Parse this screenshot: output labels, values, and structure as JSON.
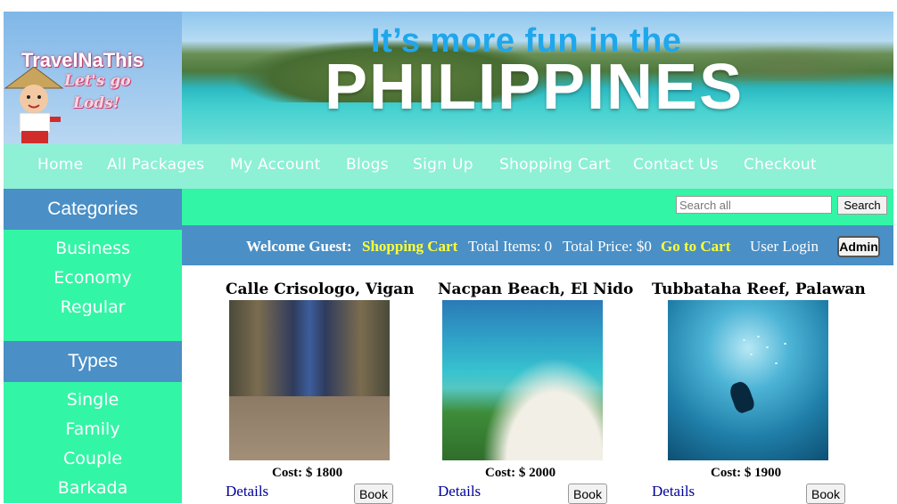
{
  "brand": {
    "name": "TravelNaThis",
    "tagline_line1": "Let's go",
    "tagline_line2": "Lods!"
  },
  "banner": {
    "tagline": "It’s more fun in the",
    "title": "PHILIPPINES"
  },
  "nav": {
    "items": [
      "Home",
      "All Packages",
      "My Account",
      "Blogs",
      "Sign Up",
      "Shopping Cart",
      "Contact Us",
      "Checkout"
    ]
  },
  "sidebar": {
    "categories": {
      "heading": "Categories",
      "items": [
        "Business",
        "Economy",
        "Regular"
      ]
    },
    "types": {
      "heading": "Types",
      "items": [
        "Single",
        "Family",
        "Couple",
        "Barkada"
      ]
    }
  },
  "search": {
    "placeholder": "Search all",
    "button_label": "Search"
  },
  "welcome": {
    "greeting": "Welcome Guest:",
    "cart_label": "Shopping Cart",
    "total_items_label": "Total Items: 0",
    "total_price_label": "Total Price: $0",
    "go_to_cart": "Go to Cart",
    "user_login": "User Login",
    "admin_button": "Admin"
  },
  "packages": [
    {
      "title": "Calle Crisologo, Vigan",
      "cost": "Cost: $ 1800",
      "details": "Details",
      "book": "Book"
    },
    {
      "title": "Nacpan Beach, El Nido",
      "cost": "Cost: $ 2000",
      "details": "Details",
      "book": "Book"
    },
    {
      "title": "Tubbataha Reef, Palawan",
      "cost": "Cost: $ 1900",
      "details": "Details",
      "book": "Book"
    }
  ],
  "colors": {
    "nav_bg": "#8ef0d4",
    "accent_green": "#33f5a6",
    "accent_blue": "#4a8fc6",
    "link_yellow": "#ffff33",
    "details_link": "#00009c"
  }
}
